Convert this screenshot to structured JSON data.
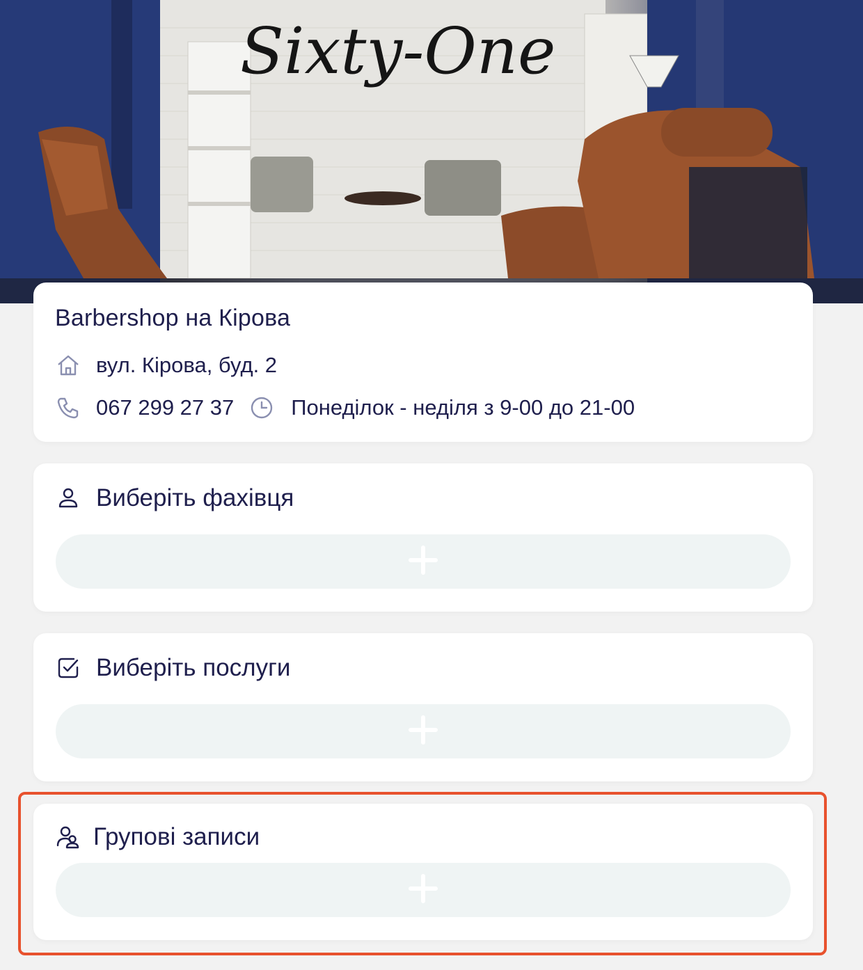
{
  "hero": {
    "image": "barbershop-interior-photo",
    "sign_text": "Sixty-One"
  },
  "shop": {
    "name": "Barbershop на Кірова",
    "address": "вул. Кірова, буд. 2",
    "phone": "067 299 27 37",
    "hours": "Понеділок - неділя з 9-00 до 21-00"
  },
  "sections": {
    "specialist": {
      "label": "Виберіть фахівця",
      "icon": "user-icon"
    },
    "services": {
      "label": "Виберіть послуги",
      "icon": "checkbox-icon"
    },
    "group": {
      "label": "Групові записи",
      "icon": "group-icon"
    }
  },
  "colors": {
    "page_bg": "#f2f2f2",
    "card_bg": "#ffffff",
    "text": "#1f1f4d",
    "icon": "#8a8fb0",
    "pill_bg": "#eff4f4",
    "plus": "#ffffff",
    "highlight": "#e8522e"
  }
}
